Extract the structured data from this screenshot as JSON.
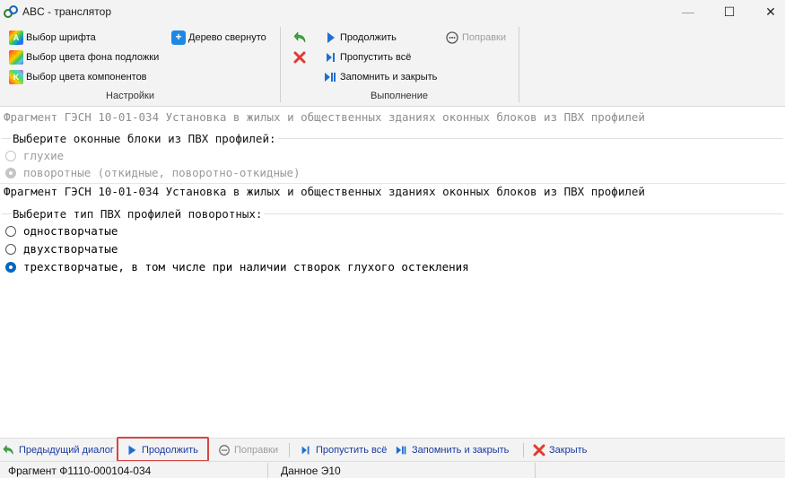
{
  "window": {
    "title": "ABC - транслятор",
    "minimize_glyph": "—",
    "maximize_glyph": "☐",
    "close_glyph": "✕"
  },
  "ribbon": {
    "settings": {
      "font_label": "Выбор шрифта",
      "bg_color_label": "Выбор цвета фона подложки",
      "comp_color_label": "Выбор цвета компонентов",
      "tree_label": "Дерево свернуто",
      "group_label": "Настройки"
    },
    "execution": {
      "continue_label": "Продолжить",
      "skip_all_label": "Пропустить всё",
      "save_close_label": "Запомнить и закрыть",
      "corrections_label": "Поправки",
      "group_label": "Выполнение"
    }
  },
  "content": {
    "fragment1": "Фрагмент ГЭСН 10-01-034 Установка в жилых и общественных зданиях оконных блоков из ПВХ профилей",
    "question1": "Выберите оконные блоки из ПВХ профилей:",
    "q1_options": [
      "глухие",
      "поворотные (откидные, поворотно-откидные)"
    ],
    "fragment2": "Фрагмент ГЭСН 10-01-034 Установка в жилых и общественных зданиях оконных блоков из ПВХ профилей",
    "question2": "Выберите тип ПВХ профилей поворотных:",
    "q2_options": [
      "одностворчатые",
      "двухстворчатые",
      "трехстворчатые, в том числе при наличии створок глухого остекления"
    ]
  },
  "toolbar": {
    "prev_label": "Предыдущий диалог",
    "continue_label": "Продолжить",
    "corrections_label": "Поправки",
    "skip_all_label": "Пропустить всё",
    "save_close_label": "Запомнить и закрыть",
    "close_label": "Закрыть"
  },
  "status": {
    "fragment": "Фрагмент  Ф1110-000104-034",
    "data": "Данное  Э10"
  },
  "colors": {
    "accent": "#0067c0",
    "highlight": "#d64541",
    "link": "#1a3a9e"
  }
}
